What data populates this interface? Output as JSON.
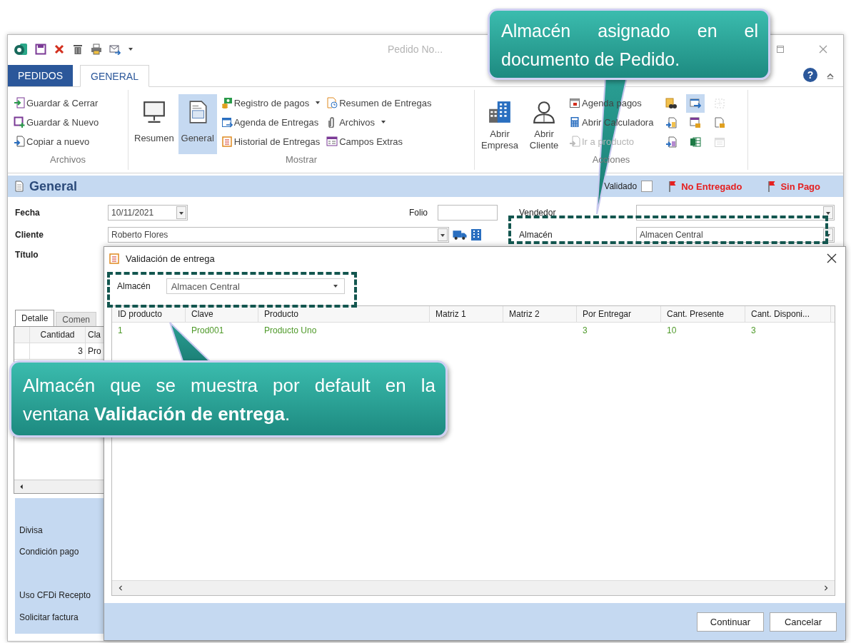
{
  "window": {
    "title": "Pedido No..."
  },
  "help_button": {
    "label": "?"
  },
  "ribbon_tabs": [
    {
      "label": "PEDIDOS",
      "kind": "file",
      "selected": false
    },
    {
      "label": "GENERAL",
      "kind": "tab",
      "selected": true
    }
  ],
  "ribbon_groups": [
    {
      "title": "Archivos",
      "items": [
        {
          "label": "Guardar & Cerrar",
          "kind": "small",
          "dropdown": false,
          "disabled": false,
          "selected": false
        },
        {
          "label": "Guardar & Nuevo",
          "kind": "small",
          "dropdown": false,
          "disabled": false,
          "selected": false
        },
        {
          "label": "Copiar a nuevo",
          "kind": "small",
          "dropdown": false,
          "disabled": false,
          "selected": false
        }
      ]
    },
    {
      "title": "Mostrar",
      "items": [
        {
          "label": "Resumen",
          "kind": "large",
          "disabled": false,
          "selected": false
        },
        {
          "label": "General",
          "kind": "large",
          "disabled": false,
          "selected": true
        },
        {
          "label": "Registro de pagos",
          "kind": "small",
          "dropdown": true,
          "disabled": false,
          "selected": false
        },
        {
          "label": "Agenda de Entregas",
          "kind": "small",
          "dropdown": false,
          "disabled": false,
          "selected": false
        },
        {
          "label": "Historial de Entregas",
          "kind": "small",
          "dropdown": false,
          "disabled": false,
          "selected": false
        },
        {
          "label": "Resumen de Entregas",
          "kind": "small",
          "dropdown": false,
          "disabled": false,
          "selected": false
        },
        {
          "label": "Archivos",
          "kind": "small",
          "dropdown": true,
          "disabled": false,
          "selected": false
        },
        {
          "label": "Campos Extras",
          "kind": "small",
          "dropdown": false,
          "disabled": false,
          "selected": false
        }
      ]
    },
    {
      "title": "Acciones",
      "items": [
        {
          "label": "Abrir Empresa",
          "kind": "large",
          "disabled": false,
          "selected": false
        },
        {
          "label": "Abrir Cliente",
          "kind": "large",
          "disabled": false,
          "selected": false
        },
        {
          "label": "Agenda pagos",
          "kind": "small",
          "dropdown": false,
          "disabled": false,
          "selected": false
        },
        {
          "label": "Abrir Calculadora",
          "kind": "small",
          "dropdown": false,
          "disabled": false,
          "selected": false
        },
        {
          "label": "Ir a producto",
          "kind": "small",
          "dropdown": false,
          "disabled": true,
          "selected": false
        }
      ],
      "icon_buttons": [
        {
          "selected": false,
          "disabled": false
        },
        {
          "selected": true,
          "disabled": false
        },
        {
          "selected": false,
          "disabled": true
        },
        {
          "selected": false,
          "disabled": false
        },
        {
          "selected": false,
          "disabled": false
        },
        {
          "selected": false,
          "disabled": false
        },
        {
          "selected": false,
          "disabled": false
        },
        {
          "selected": false,
          "disabled": false
        },
        {
          "selected": false,
          "disabled": true
        }
      ]
    }
  ],
  "section": {
    "title": "General",
    "validado": {
      "label": "Validado",
      "checked": false
    },
    "flags": [
      {
        "label": "No Entregado"
      },
      {
        "label": "Sin Pago"
      }
    ]
  },
  "form": {
    "fecha": {
      "label": "Fecha",
      "value": "10/11/2021"
    },
    "folio": {
      "label": "Folio"
    },
    "cliente": {
      "label": "Cliente",
      "value": "Roberto Flores"
    },
    "titulo": {
      "label": "Título"
    },
    "vendedor": {
      "label": "Vendedor"
    },
    "almacen": {
      "label": "Almacén",
      "value": "Almacen Central"
    }
  },
  "detail_tabs": [
    {
      "label": "Detalle",
      "selected": true
    },
    {
      "label": "Comen",
      "selected": false
    }
  ],
  "detail_grid": {
    "columns": [
      "Cantidad",
      "Cla"
    ],
    "rows": [
      [
        "3",
        "Pro"
      ]
    ]
  },
  "footer_fields": [
    "Divisa",
    "Condición pago",
    "Uso CFDi Recepto",
    "Solicitar factura"
  ],
  "dialog": {
    "title": "Validación de entrega",
    "almacen": {
      "label": "Almacén",
      "value": "Almacen Central"
    },
    "columns": [
      "ID producto",
      "Clave",
      "Producto",
      "Matriz 1",
      "Matriz 2",
      "Por Entregar",
      "Cant. Presente",
      "Cant. Disponi..."
    ],
    "rows": [
      [
        "1",
        "Prod001",
        "Producto Uno",
        null,
        null,
        "3",
        "10",
        "3"
      ]
    ],
    "buttons": [
      {
        "label": "Continuar"
      },
      {
        "label": "Cancelar"
      }
    ]
  },
  "callouts": [
    {
      "text": "Almacén asignado en el documento de Pedido."
    },
    {
      "text": "Almacén que se muestra por default en la ventana **Validación de entrega**."
    }
  ]
}
